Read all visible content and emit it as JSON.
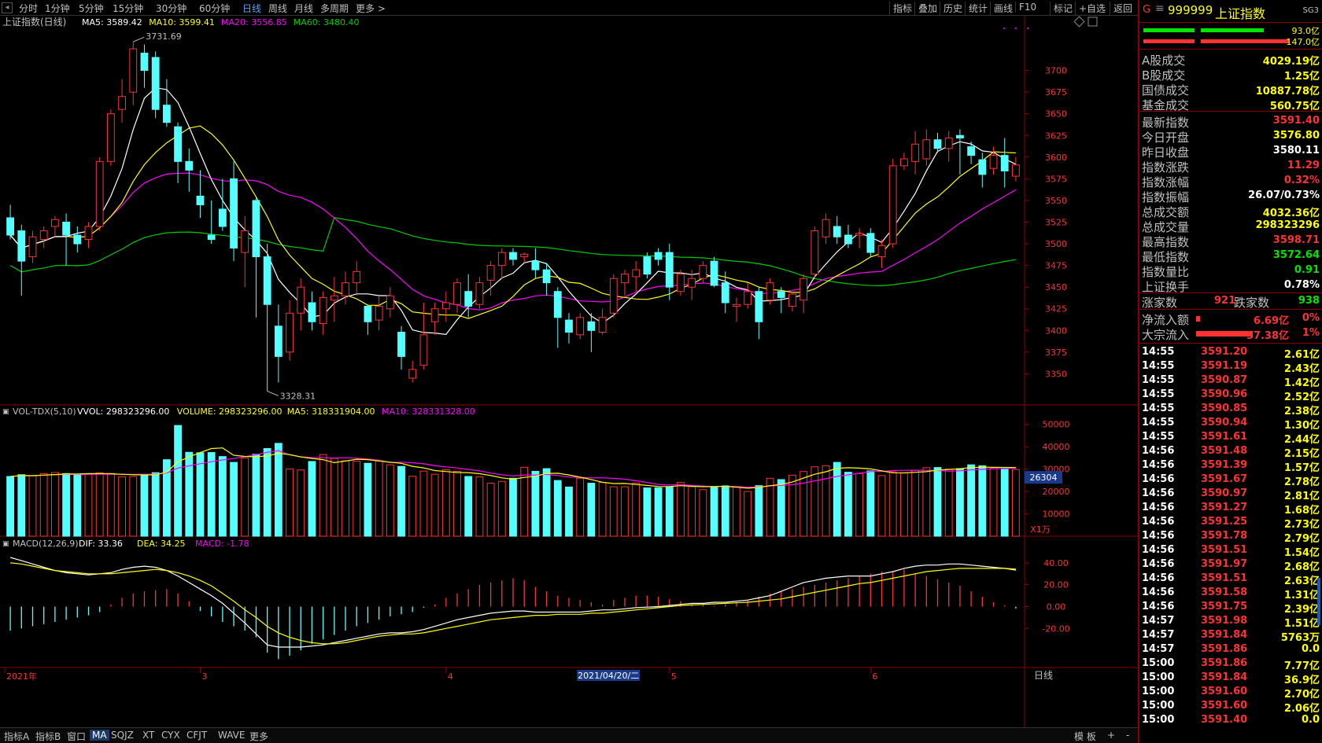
{
  "toolbar": {
    "periods": [
      "分时",
      "1分钟",
      "5分钟",
      "15分钟",
      "30分钟",
      "60分钟",
      "日线",
      "周线",
      "月线",
      "多周期",
      "更多 >"
    ],
    "active_period": "日线",
    "right_tools": [
      "指标",
      "叠加",
      "历史",
      "统计",
      "画线",
      "F10",
      "标记",
      "+自选",
      "返回"
    ]
  },
  "main_chart": {
    "title": "上证指数(日线)",
    "ma_labels": [
      {
        "text": "MA5: 3589.42",
        "color": "#ffffff"
      },
      {
        "text": "MA10: 3599.41",
        "color": "#ffff00"
      },
      {
        "text": "MA20: 3556.85",
        "color": "#ff00ff"
      },
      {
        "text": "MA60: 3480.40",
        "color": "#00cc00"
      }
    ],
    "high_marker": "3731.69",
    "low_marker": "3328.31",
    "y_ticks": [
      3700,
      3675,
      3650,
      3625,
      3600,
      3575,
      3550,
      3525,
      3500,
      3475,
      3450,
      3425,
      3400,
      3375,
      3350
    ],
    "y_range": [
      3315,
      3745
    ]
  },
  "volume_chart": {
    "title": "VOL-TDX(5,10)",
    "labels": [
      {
        "text": "VVOL: 298323296.00",
        "color": "#ffffff"
      },
      {
        "text": "VOLUME: 298323296.00",
        "color": "#ffff00"
      },
      {
        "text": "MA5: 318331904.00",
        "color": "#ffff00"
      },
      {
        "text": "MA10: 328331328.00",
        "color": "#ff00ff"
      }
    ],
    "y_ticks": [
      50000,
      40000,
      30000,
      20000,
      10000
    ],
    "y_range": [
      0,
      52000
    ],
    "cursor_value": "26304",
    "unit": "X1万"
  },
  "macd_chart": {
    "title": "MACD(12,26,9)",
    "labels": [
      {
        "text": "DIF: 33.36",
        "color": "#ffffff"
      },
      {
        "text": "DEA: 34.25",
        "color": "#ffff00"
      },
      {
        "text": "MACD: -1.78",
        "color": "#ff00ff"
      }
    ],
    "y_ticks": [
      "40.00",
      "20.00",
      "0.00",
      "-20.00"
    ],
    "y_values": [
      40,
      20,
      0,
      -20
    ],
    "y_range": [
      -55,
      50
    ]
  },
  "x_axis": {
    "labels": [
      {
        "text": "2021年",
        "idx": 0
      },
      {
        "text": "3",
        "idx": 17
      },
      {
        "text": "4",
        "idx": 39
      },
      {
        "text": "5",
        "idx": 59
      },
      {
        "text": "6",
        "idx": 77
      }
    ],
    "cursor_label": "2021/04/20/二",
    "cursor_idx": 51,
    "period_label": "日线"
  },
  "chart_data": {
    "type": "candlestick",
    "title": "上证指数(日线)",
    "ohlc": [
      [
        3530,
        3545,
        3505,
        3510
      ],
      [
        3515,
        3522,
        3440,
        3480
      ],
      [
        3485,
        3515,
        3478,
        3508
      ],
      [
        3505,
        3520,
        3495,
        3515
      ],
      [
        3520,
        3532,
        3508,
        3528
      ],
      [
        3525,
        3535,
        3475,
        3510
      ],
      [
        3510,
        3520,
        3490,
        3500
      ],
      [
        3505,
        3525,
        3495,
        3520
      ],
      [
        3520,
        3600,
        3515,
        3595
      ],
      [
        3595,
        3655,
        3590,
        3650
      ],
      [
        3655,
        3690,
        3640,
        3670
      ],
      [
        3675,
        3733,
        3660,
        3725
      ],
      [
        3720,
        3730,
        3680,
        3700
      ],
      [
        3715,
        3722,
        3645,
        3655
      ],
      [
        3660,
        3690,
        3635,
        3640
      ],
      [
        3635,
        3640,
        3570,
        3595
      ],
      [
        3595,
        3610,
        3560,
        3585
      ],
      [
        3555,
        3585,
        3530,
        3545
      ],
      [
        3510,
        3550,
        3500,
        3505
      ],
      [
        3540,
        3575,
        3515,
        3520
      ],
      [
        3575,
        3595,
        3480,
        3495
      ],
      [
        3490,
        3532,
        3450,
        3515
      ],
      [
        3550,
        3553,
        3415,
        3485
      ],
      [
        3485,
        3500,
        3330,
        3430
      ],
      [
        3405,
        3430,
        3340,
        3370
      ],
      [
        3375,
        3435,
        3365,
        3420
      ],
      [
        3420,
        3460,
        3400,
        3450
      ],
      [
        3432,
        3445,
        3400,
        3410
      ],
      [
        3408,
        3445,
        3395,
        3438
      ],
      [
        3435,
        3462,
        3410,
        3440
      ],
      [
        3440,
        3468,
        3430,
        3455
      ],
      [
        3455,
        3480,
        3440,
        3468
      ],
      [
        3428,
        3430,
        3395,
        3410
      ],
      [
        3412,
        3440,
        3400,
        3428
      ],
      [
        3425,
        3450,
        3415,
        3440
      ],
      [
        3398,
        3405,
        3355,
        3370
      ],
      [
        3345,
        3365,
        3340,
        3355
      ],
      [
        3360,
        3432,
        3355,
        3395
      ],
      [
        3410,
        3432,
        3395,
        3425
      ],
      [
        3425,
        3445,
        3410,
        3432
      ],
      [
        3430,
        3460,
        3420,
        3455
      ],
      [
        3445,
        3465,
        3415,
        3428
      ],
      [
        3430,
        3462,
        3425,
        3455
      ],
      [
        3458,
        3480,
        3440,
        3475
      ],
      [
        3475,
        3495,
        3460,
        3490
      ],
      [
        3490,
        3495,
        3475,
        3482
      ],
      [
        3485,
        3490,
        3478,
        3488
      ],
      [
        3480,
        3495,
        3460,
        3470
      ],
      [
        3470,
        3478,
        3440,
        3455
      ],
      [
        3445,
        3450,
        3380,
        3415
      ],
      [
        3412,
        3420,
        3385,
        3398
      ],
      [
        3395,
        3420,
        3390,
        3415
      ],
      [
        3410,
        3420,
        3375,
        3400
      ],
      [
        3398,
        3425,
        3395,
        3415
      ],
      [
        3420,
        3465,
        3415,
        3460
      ],
      [
        3455,
        3470,
        3440,
        3465
      ],
      [
        3462,
        3480,
        3445,
        3470
      ],
      [
        3485,
        3490,
        3460,
        3465
      ],
      [
        3490,
        3495,
        3475,
        3482
      ],
      [
        3490,
        3500,
        3435,
        3450
      ],
      [
        3445,
        3470,
        3440,
        3465
      ],
      [
        3450,
        3470,
        3435,
        3460
      ],
      [
        3460,
        3480,
        3455,
        3475
      ],
      [
        3480,
        3485,
        3450,
        3452
      ],
      [
        3455,
        3468,
        3420,
        3432
      ],
      [
        3428,
        3438,
        3410,
        3430
      ],
      [
        3430,
        3455,
        3425,
        3445
      ],
      [
        3445,
        3450,
        3390,
        3410
      ],
      [
        3435,
        3460,
        3430,
        3455
      ],
      [
        3445,
        3450,
        3420,
        3438
      ],
      [
        3428,
        3445,
        3422,
        3442
      ],
      [
        3435,
        3465,
        3420,
        3460
      ],
      [
        3465,
        3520,
        3460,
        3515
      ],
      [
        3508,
        3535,
        3500,
        3528
      ],
      [
        3520,
        3532,
        3500,
        3508
      ],
      [
        3510,
        3522,
        3495,
        3500
      ],
      [
        3510,
        3518,
        3495,
        3512
      ],
      [
        3512,
        3518,
        3485,
        3490
      ],
      [
        3485,
        3505,
        3472,
        3498
      ],
      [
        3500,
        3598,
        3495,
        3590
      ],
      [
        3590,
        3605,
        3585,
        3598
      ],
      [
        3595,
        3630,
        3580,
        3615
      ],
      [
        3598,
        3632,
        3590,
        3620
      ],
      [
        3620,
        3628,
        3605,
        3610
      ],
      [
        3610,
        3630,
        3595,
        3622
      ],
      [
        3625,
        3632,
        3580,
        3622
      ],
      [
        3612,
        3618,
        3592,
        3602
      ],
      [
        3597,
        3605,
        3565,
        3580
      ],
      [
        3587,
        3612,
        3580,
        3602
      ],
      [
        3602,
        3622,
        3565,
        3584
      ],
      [
        3578,
        3600,
        3572,
        3591
      ]
    ],
    "volume": [
      26700,
      27500,
      27000,
      28000,
      28500,
      28000,
      27500,
      27800,
      28300,
      28000,
      26600,
      26700,
      27500,
      28400,
      34200,
      49500,
      37500,
      37300,
      37400,
      35600,
      33000,
      35000,
      36600,
      39200,
      41500,
      30100,
      29600,
      33400,
      36500,
      34800,
      33700,
      33500,
      32600,
      33600,
      31900,
      31200,
      26800,
      29100,
      27700,
      29700,
      29000,
      26700,
      26500,
      23700,
      24500,
      25900,
      30800,
      29000,
      30200,
      24900,
      22000,
      25900,
      23700,
      24000,
      22100,
      22100,
      23700,
      21600,
      21700,
      22000,
      24000,
      22200,
      20800,
      22000,
      22500,
      22000,
      20000,
      22600,
      25900,
      25300,
      27300,
      28900,
      31000,
      31500,
      33000,
      28600,
      28000,
      29200,
      27100,
      28800,
      28300,
      29400,
      30600,
      30700,
      30000,
      30200,
      31900,
      31500,
      30300,
      29900,
      29800
    ],
    "macd": [
      -22,
      -20,
      -18,
      -16,
      -14,
      -12,
      -10,
      -8,
      -5,
      2,
      8,
      12,
      14,
      15,
      16,
      12,
      5,
      -4,
      -9,
      -14,
      -18,
      -22,
      -28,
      -42,
      -48,
      -45,
      -40,
      -34,
      -30,
      -26,
      -22,
      -18,
      -15,
      -12,
      -9,
      -7,
      -5,
      -1,
      2,
      8,
      12,
      16,
      20,
      22,
      24,
      26,
      24,
      18,
      14,
      10,
      8,
      6,
      4,
      2,
      6,
      8,
      10,
      10,
      9,
      7,
      5,
      3,
      2,
      1,
      2,
      4,
      6,
      9,
      12,
      14,
      16,
      18,
      20,
      22,
      24,
      26,
      28,
      30,
      32,
      32,
      34,
      30,
      28,
      25,
      22,
      19,
      14,
      9,
      4,
      1,
      -1.78
    ],
    "dif": [
      45,
      42,
      39,
      36,
      33,
      31,
      30,
      29,
      30,
      31,
      34,
      36,
      37,
      36,
      33,
      28,
      22,
      16,
      10,
      3,
      -6,
      -15,
      -25,
      -35,
      -37,
      -37,
      -37,
      -36,
      -35,
      -33,
      -31,
      -29,
      -27,
      -25,
      -24,
      -24,
      -23,
      -21,
      -18,
      -15,
      -12,
      -10,
      -8,
      -6,
      -5,
      -4,
      -4,
      -5,
      -5,
      -5,
      -5,
      -5,
      -4,
      -3,
      -3,
      -2,
      -1,
      -0.5,
      0,
      1,
      2,
      3,
      3,
      4,
      4,
      5,
      6,
      8,
      10,
      14,
      18,
      22,
      24,
      26,
      27,
      28,
      28,
      28,
      30,
      32,
      35,
      37,
      38,
      38,
      39,
      39,
      38,
      37,
      36,
      35,
      33.36
    ],
    "dea": [
      40,
      39,
      37,
      35,
      33,
      32,
      31,
      30,
      30,
      30,
      31,
      32,
      33,
      34,
      33,
      31,
      28,
      24,
      19,
      12,
      5,
      -3,
      -10,
      -18,
      -24,
      -28,
      -31,
      -33,
      -34,
      -34,
      -33,
      -31,
      -29,
      -27,
      -26,
      -25,
      -25,
      -24,
      -22,
      -20,
      -18,
      -16,
      -14,
      -12,
      -11,
      -10,
      -9,
      -8,
      -8,
      -7,
      -7,
      -7,
      -6,
      -6,
      -5,
      -4,
      -3,
      -2,
      -1,
      0,
      1,
      1.5,
      2,
      2.5,
      3,
      3.5,
      4,
      5,
      6,
      7,
      9,
      11,
      13,
      15,
      17,
      19,
      21,
      22,
      24,
      26,
      28,
      30,
      32,
      33,
      34,
      35,
      35,
      35,
      35,
      35,
      34.25
    ]
  },
  "side_panel": {
    "header": {
      "code": "999999",
      "name": "上证指数",
      "tag": "SG3",
      "flag": "G",
      "bar1_val": "93.0亿",
      "bar2_val": "147.0亿"
    },
    "trade_rows": [
      {
        "label": "A股成交",
        "value": "4029.19亿"
      },
      {
        "label": "B股成交",
        "value": "1.25亿"
      },
      {
        "label": "国债成交",
        "value": "10887.78亿"
      },
      {
        "label": "基金成交",
        "value": "560.75亿"
      }
    ],
    "stat_rows": [
      {
        "label": "最新指数",
        "value": "3591.40",
        "color": "red"
      },
      {
        "label": "今日开盘",
        "value": "3576.80",
        "color": "yellow"
      },
      {
        "label": "昨日收盘",
        "value": "3580.11",
        "color": "white"
      },
      {
        "label": "指数涨跌",
        "value": "11.29",
        "color": "red"
      },
      {
        "label": "指数涨幅",
        "value": "0.32%",
        "color": "red"
      },
      {
        "label": "指数振幅",
        "value": "26.07/0.73%",
        "color": "white"
      },
      {
        "label": "总成交额",
        "value": "4032.36亿",
        "color": "yellow"
      },
      {
        "label": "总成交量",
        "value": "298323296",
        "color": "yellow"
      },
      {
        "label": "最高指数",
        "value": "3598.71",
        "color": "red"
      },
      {
        "label": "最低指数",
        "value": "3572.64",
        "color": "green"
      },
      {
        "label": "指数量比",
        "value": "0.91",
        "color": "green"
      },
      {
        "label": "上证换手",
        "value": "0.78%",
        "color": "white"
      }
    ],
    "breadth": {
      "up_label": "涨家数",
      "up_value": "921",
      "down_label": "跌家数",
      "down_value": "938"
    },
    "flows": [
      {
        "label": "净流入额",
        "value": "6.69亿",
        "pct": "0%",
        "bar_fraction": 0.04
      },
      {
        "label": "大宗流入",
        "value": "57.38亿",
        "pct": "1%",
        "bar_fraction": 0.55
      }
    ],
    "ticks": [
      [
        "14:55",
        "3591.20",
        "2.61亿"
      ],
      [
        "14:55",
        "3591.19",
        "2.43亿"
      ],
      [
        "14:55",
        "3590.87",
        "1.42亿"
      ],
      [
        "14:55",
        "3590.96",
        "2.52亿"
      ],
      [
        "14:55",
        "3590.85",
        "2.38亿"
      ],
      [
        "14:55",
        "3590.94",
        "1.30亿"
      ],
      [
        "14:55",
        "3591.61",
        "2.44亿"
      ],
      [
        "14:56",
        "3591.48",
        "2.15亿"
      ],
      [
        "14:56",
        "3591.39",
        "1.57亿"
      ],
      [
        "14:56",
        "3591.67",
        "2.78亿"
      ],
      [
        "14:56",
        "3590.97",
        "2.81亿"
      ],
      [
        "14:56",
        "3591.27",
        "1.68亿"
      ],
      [
        "14:56",
        "3591.25",
        "2.73亿"
      ],
      [
        "14:56",
        "3591.78",
        "2.79亿"
      ],
      [
        "14:56",
        "3591.51",
        "1.54亿"
      ],
      [
        "14:56",
        "3591.97",
        "2.68亿"
      ],
      [
        "14:56",
        "3591.51",
        "2.63亿"
      ],
      [
        "14:56",
        "3591.58",
        "1.31亿"
      ],
      [
        "14:56",
        "3591.75",
        "2.39亿"
      ],
      [
        "14:57",
        "3591.98",
        "1.51亿"
      ],
      [
        "14:57",
        "3591.84",
        "5763万"
      ],
      [
        "14:57",
        "3591.86",
        "0.0"
      ],
      [
        "15:00",
        "3591.86",
        "7.77亿"
      ],
      [
        "15:00",
        "3591.84",
        "36.9亿"
      ],
      [
        "15:00",
        "3591.60",
        "2.70亿"
      ],
      [
        "15:00",
        "3591.60",
        "2.06亿"
      ],
      [
        "15:00",
        "3591.40",
        "0.0"
      ]
    ]
  },
  "bottombar": {
    "tabs": [
      "指标A",
      "指标B",
      "窗口",
      "MA",
      "SQJZ",
      "XT",
      "CYX",
      "CFJT",
      "WAVE",
      "更多"
    ],
    "active_tab": "MA",
    "right_items": [
      "模 板",
      "+",
      "-"
    ]
  },
  "colors": {
    "up": "#ff3232",
    "down": "#54ffff",
    "ma5": "#ffffff",
    "ma10": "#ffff00",
    "ma20": "#ff00ff",
    "ma60": "#00cc00",
    "axis_text": "#ff3232",
    "frame": "#8b0000"
  }
}
